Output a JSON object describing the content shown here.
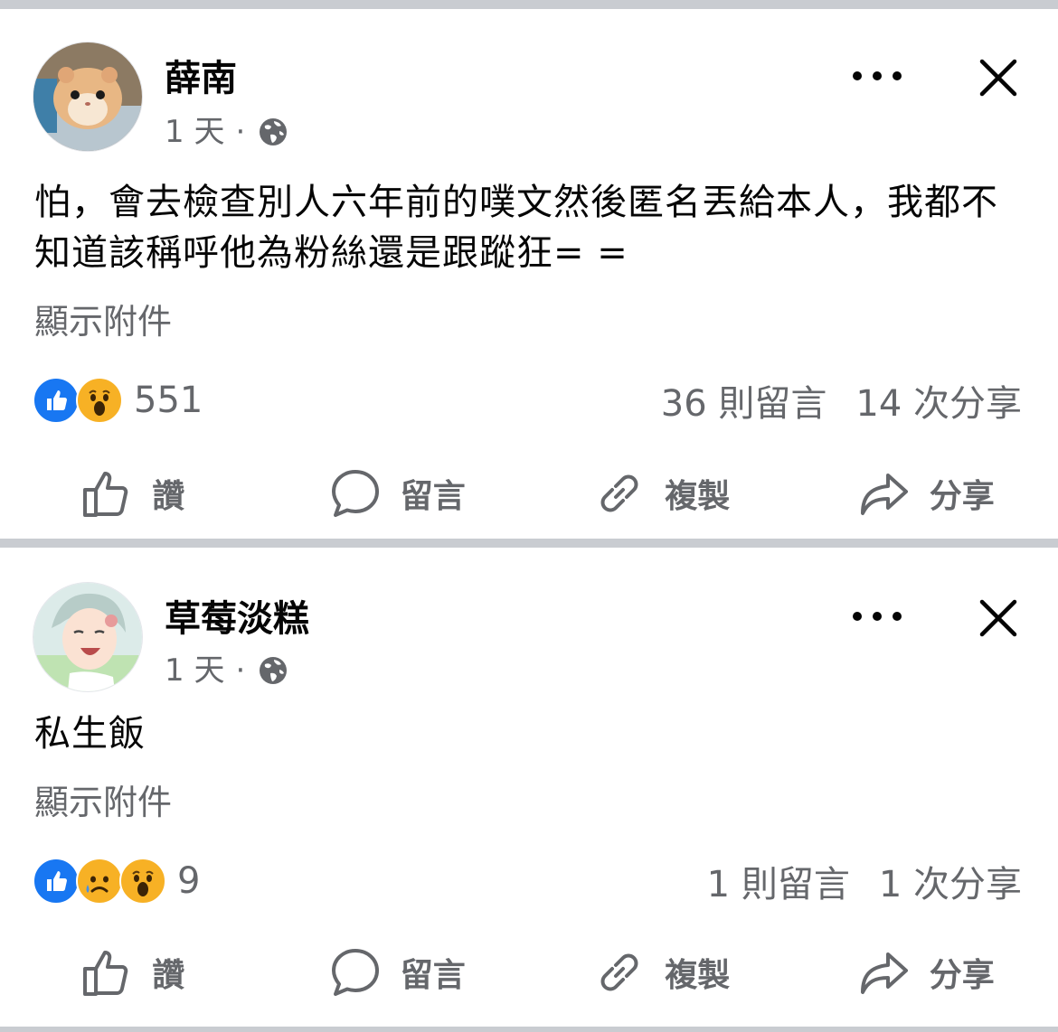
{
  "posts": [
    {
      "author": "薛南",
      "time": "1 天",
      "dot": "·",
      "globe_icon": "globe-icon",
      "body": "怕，會去檢查別人六年前的噗文然後匿名丟給本人，我都不知道該稱呼他為粉絲還是跟蹤狂= =",
      "attachment": "顯示附件",
      "reactions": [
        "like",
        "wow"
      ],
      "reaction_count": "551",
      "comments": "36 則留言",
      "shares": "14 次分享",
      "actions": {
        "like": "讚",
        "comment": "留言",
        "copy": "複製",
        "share": "分享"
      }
    },
    {
      "author": "草莓淡糕",
      "time": "1 天",
      "dot": "·",
      "globe_icon": "globe-icon",
      "body": "私生飯",
      "attachment": "顯示附件",
      "reactions": [
        "like",
        "sad",
        "wow"
      ],
      "reaction_count": "9",
      "comments": "1 則留言",
      "shares": "1 次分享",
      "actions": {
        "like": "讚",
        "comment": "留言",
        "copy": "複製",
        "share": "分享"
      }
    }
  ],
  "colors": {
    "like_blue": "#1877f2",
    "emoji_yellow": "#f7b125",
    "secondary_text": "#65676b"
  }
}
